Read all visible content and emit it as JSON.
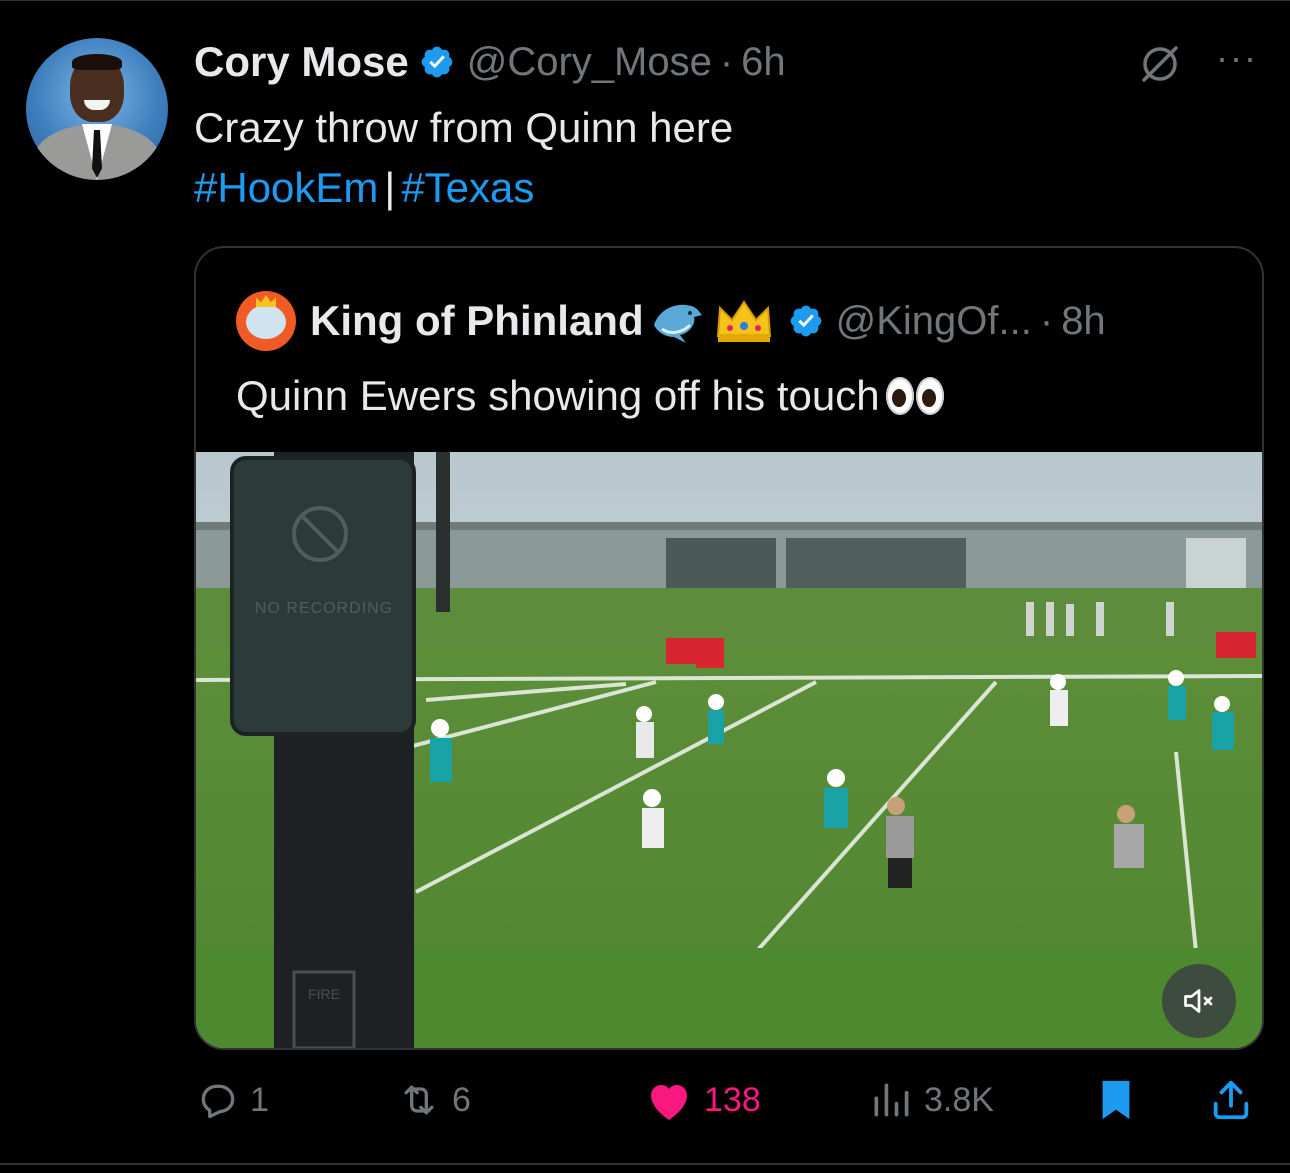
{
  "tweet": {
    "author_name": "Cory Mose",
    "author_handle": "@Cory_Mose",
    "separator": "·",
    "time": "6h",
    "text": "Crazy throw from Quinn here",
    "hashtags": [
      "#HookEm",
      "#Texas"
    ],
    "hashtag_separator": "|",
    "more_label": "···"
  },
  "quote": {
    "author_name": "King of Phinland",
    "author_handle": "@KingOf...",
    "separator": "·",
    "time": "8h",
    "text": "Quinn Ewers showing off his touch"
  },
  "video": {
    "sign_text": "NO RECORDING",
    "post_text": "FIRE",
    "muted": true
  },
  "actions": {
    "replies": "1",
    "reposts": "6",
    "likes": "138",
    "views": "3.8K"
  },
  "colors": {
    "background": "#000000",
    "text": "#e7e9ea",
    "secondary": "#71767b",
    "link": "#1d9bf0",
    "like": "#f91880",
    "verified": "#1d9bf0",
    "bookmark": "#1d9bf0"
  },
  "icons": {
    "verified": "verified-badge-icon",
    "grok": "grok-icon",
    "more": "more-icon",
    "reply": "reply-icon",
    "repost": "repost-icon",
    "like": "heart-icon",
    "views": "views-icon",
    "bookmark": "bookmark-icon",
    "share": "share-icon",
    "mute": "mute-icon"
  }
}
